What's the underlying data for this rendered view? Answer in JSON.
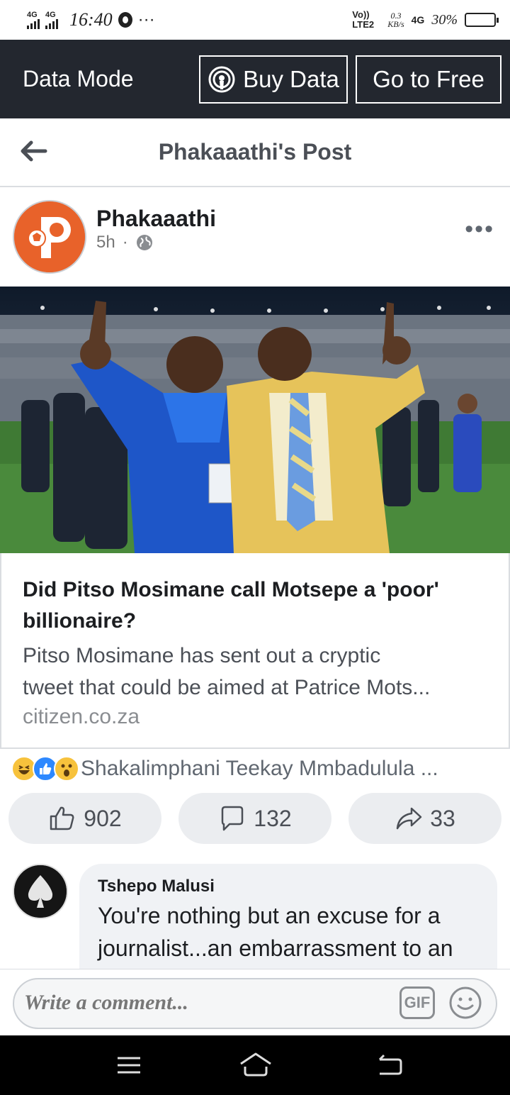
{
  "status_bar": {
    "network_1": "4G",
    "network_2": "4G",
    "time": "16:40",
    "extra": "···",
    "volte": "Vo)) LTE2",
    "speed_value": "0.3",
    "speed_unit": "KB/s",
    "network_3": "4G",
    "battery": "30%",
    "battery_level": 0.3
  },
  "data_bar": {
    "label": "Data Mode",
    "buy_label": "Buy Data",
    "free_label": "Go to Free"
  },
  "header": {
    "title": "Phakaaathi's Post"
  },
  "post": {
    "author": "Phakaaathi",
    "time": "5h",
    "separator": "·",
    "link": {
      "headline": "Did Pitso Mosimane call Motsepe a 'poor' billionaire?",
      "description_line1": "Pitso Mosimane has sent out a cryptic",
      "description_line2": "tweet that could be aimed at Patrice Mots...",
      "domain": "citizen.co.za"
    },
    "reactions_text": "Shakalimphani Teekay Mmbadulula ...",
    "likes": "902",
    "comments": "132",
    "shares": "33"
  },
  "comment": {
    "author": "Tshepo Malusi",
    "line1": "You're nothing but an excuse for a",
    "line2": "journalist...an embarrassment to an"
  },
  "composer": {
    "placeholder": "Write a comment...",
    "gif_label": "GIF"
  },
  "colors": {
    "data_bar_bg": "#23272f",
    "avatar_orange": "#e8622a",
    "pill_bg": "#ebedf0",
    "bubble_bg": "#f0f2f5"
  }
}
